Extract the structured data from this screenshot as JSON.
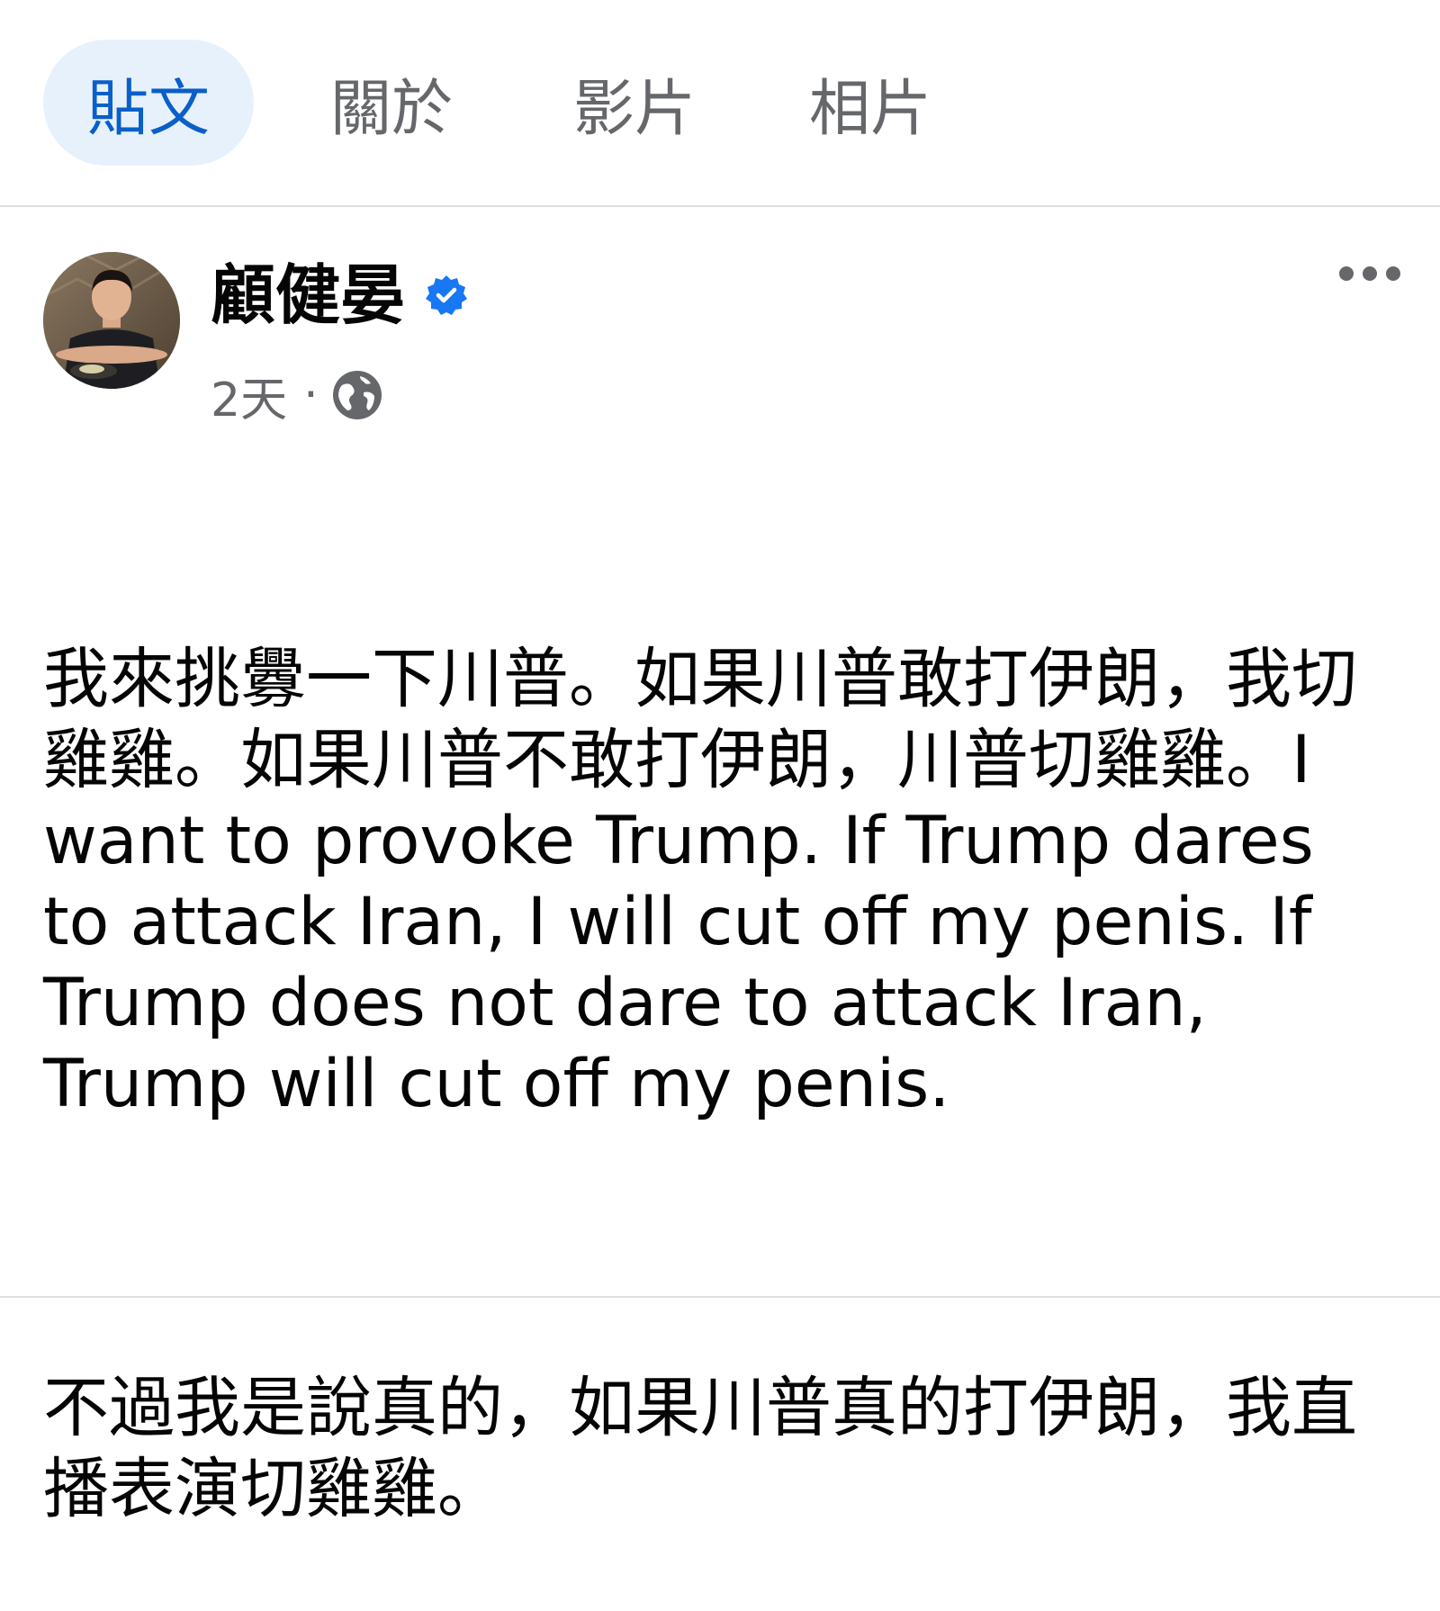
{
  "tabs": [
    {
      "label": "貼文",
      "active": true
    },
    {
      "label": "關於",
      "active": false
    },
    {
      "label": "影片",
      "active": false
    },
    {
      "label": "相片",
      "active": false
    }
  ],
  "post": {
    "author": "顧健晏",
    "verified": true,
    "timestamp": "2天",
    "separator": "·",
    "audience_icon": "globe-icon",
    "menu_icon": "more-horizontal-icon",
    "paragraphs": [
      "我來挑釁一下川普。如果川普敢打伊朗，我切雞雞。如果川普不敢打伊朗，川普切雞雞。I want to provoke Trump. If Trump dares to attack Iran, I will cut off my penis. If Trump does not dare to attack Iran, Trump will cut off my penis.",
      "不過我是說真的，如果川普真的打伊朗，我直播表演切雞雞。"
    ]
  },
  "colors": {
    "accent": "#0a5fc8",
    "active_tab_bg": "#e7f1fc",
    "secondary_text": "#65676b",
    "verified_badge": "#1877f2",
    "divider": "#dcdee2"
  }
}
